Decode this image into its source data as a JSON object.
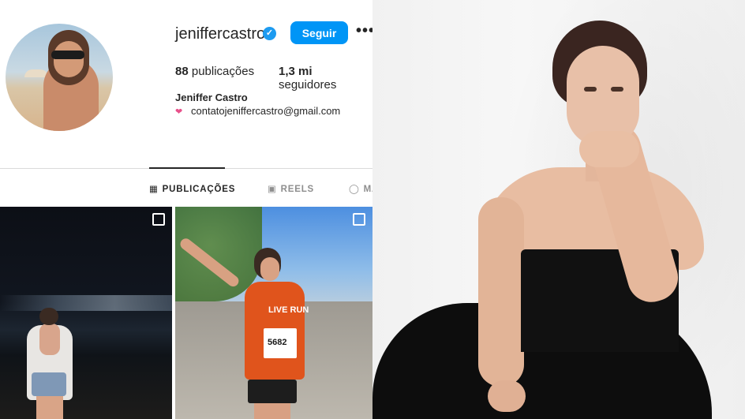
{
  "profile": {
    "username": "jeniffercastro",
    "verified_icon": "verified-badge-icon",
    "follow_label": "Seguir",
    "more_label": "•••",
    "posts_count": "88",
    "posts_label": "publicações",
    "followers_count": "1,3 mi",
    "followers_label": "seguidores",
    "full_name": "Jeniffer Castro",
    "contact_icon": "heart-icon",
    "contact_email": "contatojeniffercastro@gmail.com"
  },
  "tabs": [
    {
      "label": "PUBLICAÇÕES",
      "icon": "grid-icon",
      "active": true
    },
    {
      "label": "REELS",
      "icon": "reels-icon",
      "active": false
    },
    {
      "label": "MA",
      "icon": "tagged-icon",
      "active": false
    }
  ],
  "posts": [
    {
      "type": "carousel",
      "icon": "multi-image-icon"
    },
    {
      "type": "carousel",
      "icon": "multi-image-icon",
      "shirt_text": "LIVE RUN",
      "bib_number": "5682"
    }
  ],
  "colors": {
    "accent": "#0095f6",
    "verified": "#1d9bf0",
    "text": "#262626",
    "muted": "#8e8e8e",
    "divider": "#dbdbdb"
  }
}
